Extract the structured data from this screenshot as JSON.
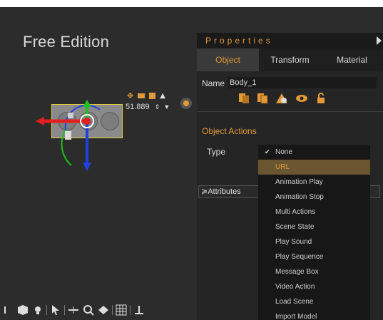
{
  "viewport": {
    "edition_label": "Free Edition",
    "value_readout": "51.889"
  },
  "properties": {
    "title": "Properties",
    "tabs": [
      "Object",
      "Transform",
      "Material"
    ],
    "active_tab": "Object",
    "name_label": "Name",
    "name_value": "Body_1",
    "section_title": "Object Actions",
    "type_label": "Type",
    "attributes_label": "Attributes"
  },
  "dropdown": {
    "selected": "None",
    "highlighted": "URL",
    "items": [
      "None",
      "URL",
      "Animation Play",
      "Animation Stop",
      "Multi Actions",
      "Scene State",
      "Play Sound",
      "Play Sequence",
      "Message Box",
      "Video Action",
      "Load Scene",
      "Import Model"
    ]
  },
  "colors": {
    "accent": "#e29a37",
    "selection_outline": "#e6cf38",
    "axis_x": "#e32020",
    "axis_y": "#20c020",
    "axis_z": "#2040e0"
  },
  "icons": {
    "row": [
      "layer-icon",
      "copy-icon",
      "mesh-icon",
      "eye-icon",
      "lock-icon"
    ],
    "toolbar": [
      "orbit-icon",
      "cube-icon",
      "light-icon",
      "select-arrow-icon",
      "move-icon",
      "zoom-icon",
      "pattern-icon",
      "grid-icon",
      "ground-icon"
    ]
  }
}
